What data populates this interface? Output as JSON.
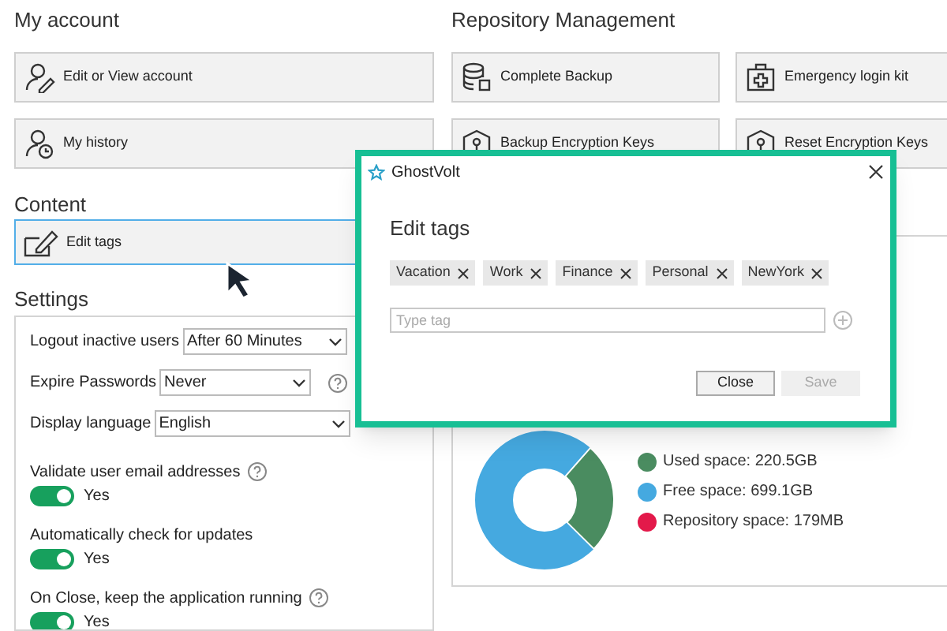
{
  "my_account": {
    "title": "My account",
    "buttons": [
      {
        "label": "Edit or View account",
        "kind": "user-edit"
      },
      {
        "label": "My history",
        "kind": "user-history"
      }
    ]
  },
  "content": {
    "title": "Content",
    "buttons": [
      {
        "label": "Edit tags",
        "kind": "edit",
        "focused": true
      }
    ]
  },
  "settings": {
    "title": "Settings",
    "fields": [
      {
        "label": "Logout inactive users",
        "value": "After 60 Minutes"
      },
      {
        "label": "Expire Passwords",
        "value": "Never",
        "help": true
      },
      {
        "label": "Display language",
        "value": "English"
      }
    ],
    "toggles": [
      {
        "label": "Validate user email addresses",
        "on": true,
        "state_label": "Yes",
        "help": true
      },
      {
        "label": "Automatically check for updates",
        "on": true,
        "state_label": "Yes",
        "help": false
      },
      {
        "label": "On Close, keep the application running",
        "on": true,
        "state_label": "Yes",
        "help": true
      }
    ]
  },
  "repository": {
    "title": "Repository Management",
    "buttons": [
      {
        "label": "Complete Backup",
        "kind": "database"
      },
      {
        "label": "Emergency login kit",
        "kind": "kit"
      },
      {
        "label": "Backup Encryption Keys",
        "kind": "key"
      },
      {
        "label": "Reset Encryption Keys",
        "kind": "key"
      }
    ],
    "legend": [
      {
        "label": "Used space: 220.5GB",
        "color": "#4a8c60"
      },
      {
        "label": "Free space: 699.1GB",
        "color": "#45a9e0"
      },
      {
        "label": "Repository space: 179MB",
        "color": "#e3194a"
      }
    ]
  },
  "dialog": {
    "app_name": "GhostVolt",
    "heading": "Edit tags",
    "tags": [
      "Vacation",
      "Work",
      "Finance",
      "Personal",
      "NewYork"
    ],
    "input": {
      "placeholder": "Type tag"
    },
    "buttons": [
      {
        "label": "Close",
        "disabled": false
      },
      {
        "label": "Save",
        "disabled": true
      }
    ]
  }
}
